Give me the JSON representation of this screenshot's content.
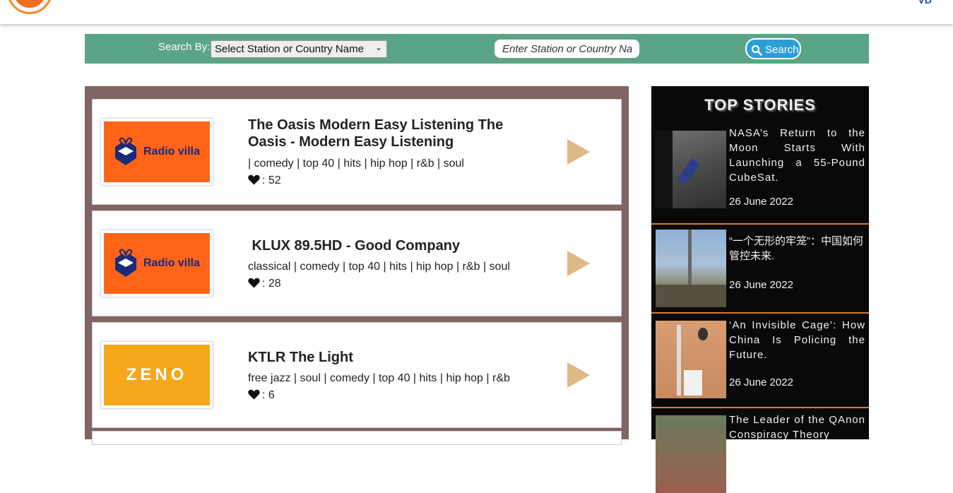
{
  "header": {
    "corner_text": "VD"
  },
  "search": {
    "search_by_label": "Search By:",
    "select_value": "Select Station or Country Name",
    "input_placeholder": "Enter Station or Country Na",
    "button_label": "Search"
  },
  "stations": [
    {
      "title": "The Oasis Modern Easy Listening The Oasis - Modern Easy Listening",
      "tags": "| comedy | top 40 | hits | hip hop | r&b | soul",
      "likes": ": 52",
      "logo_text": "Radio villa"
    },
    {
      "title": " KLUX 89.5HD - Good Company",
      "tags": "classical | comedy | top 40 | hits | hip hop | r&b | soul",
      "likes": ": 28",
      "logo_text": "Radio villa"
    },
    {
      "title": "KTLR The Light",
      "tags": "free jazz | soul | comedy | top 40 | hits | hip hop | r&b",
      "likes": ": 6",
      "logo_text": "ZENO"
    }
  ],
  "top_stories": {
    "title": "TOP STORIES",
    "items": [
      {
        "headline": "NASA’s Return to the Moon Starts With Launching a 55-Pound CubeSat.",
        "date": "26 June 2022"
      },
      {
        "headline": "“一个无形的牢笼”：中国如何管控未来.",
        "date": "26 June 2022"
      },
      {
        "headline": "‘An Invisible Cage’: How China Is Policing the Future.",
        "date": "26 June 2022"
      },
      {
        "headline": "The Leader of the QAnon Conspiracy Theory",
        "date": ""
      }
    ]
  },
  "colors": {
    "searchbar_bg": "#5aa585",
    "panel_bg": "#816464",
    "play_icon": "#deb887",
    "radio_villa_bg": "#ff6418",
    "zeno_bg": "#f5a81c",
    "story_divider": "#d97a2a"
  }
}
